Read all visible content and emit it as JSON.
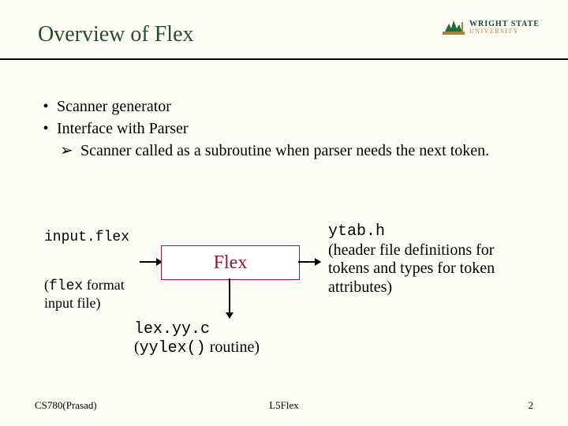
{
  "title": "Overview of Flex",
  "logo": {
    "line1": "WRIGHT STATE",
    "line2": "UNIVERSITY"
  },
  "bullets": {
    "b1": "Scanner generator",
    "b2": "Interface with Parser",
    "sub1": "Scanner called as a subroutine when parser needs the next token."
  },
  "diagram": {
    "input_file": "input.flex",
    "input_note_open": "(",
    "input_note_mono": "flex",
    "input_note_rest": " format",
    "input_note_line2": " input file)",
    "box": "Flex",
    "out_bottom_mono1": "lex.yy.c",
    "out_bottom_open": "(",
    "out_bottom_mono2": "yylex()",
    "out_bottom_rest": " routine)",
    "out_right_mono": "ytab.h",
    "out_right_rest": "(header file definitions for tokens and types for token attributes)"
  },
  "footer": {
    "left": "CS780(Prasad)",
    "center": "L5Flex",
    "right": "2"
  }
}
